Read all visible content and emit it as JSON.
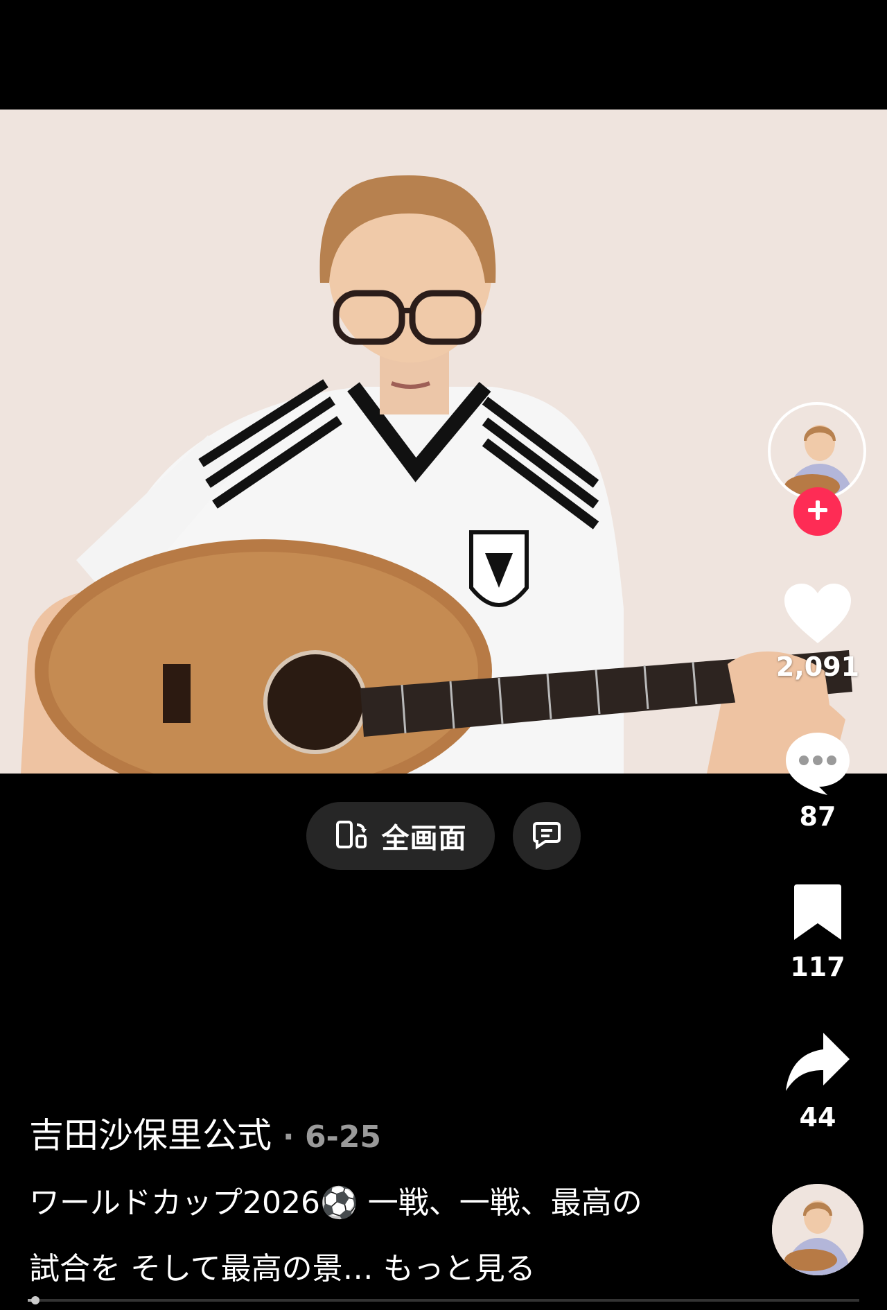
{
  "player": {
    "fullscreen_label": "全画面",
    "like_count": "2,091",
    "comment_count": "87",
    "bookmark_count": "117",
    "share_count": "44",
    "progress_fraction": 0.01
  },
  "post": {
    "author": "吉田沙保里公式",
    "date": "· 6-25",
    "caption": "ワールドカップ2026⚽ 一戦、一戦、最高の試合を そして最高の景…",
    "more": "もっと見る"
  },
  "colors": {
    "follow_badge": "#fe2c55",
    "pill_background": "#262626"
  },
  "icons": {
    "fullscreen": "rotate-screen-icon",
    "secondary": "caption-translate-icon",
    "like": "heart-icon",
    "comment": "speech-bubble-icon",
    "bookmark": "bookmark-icon",
    "share": "share-arrow-icon",
    "follow": "plus-icon"
  }
}
